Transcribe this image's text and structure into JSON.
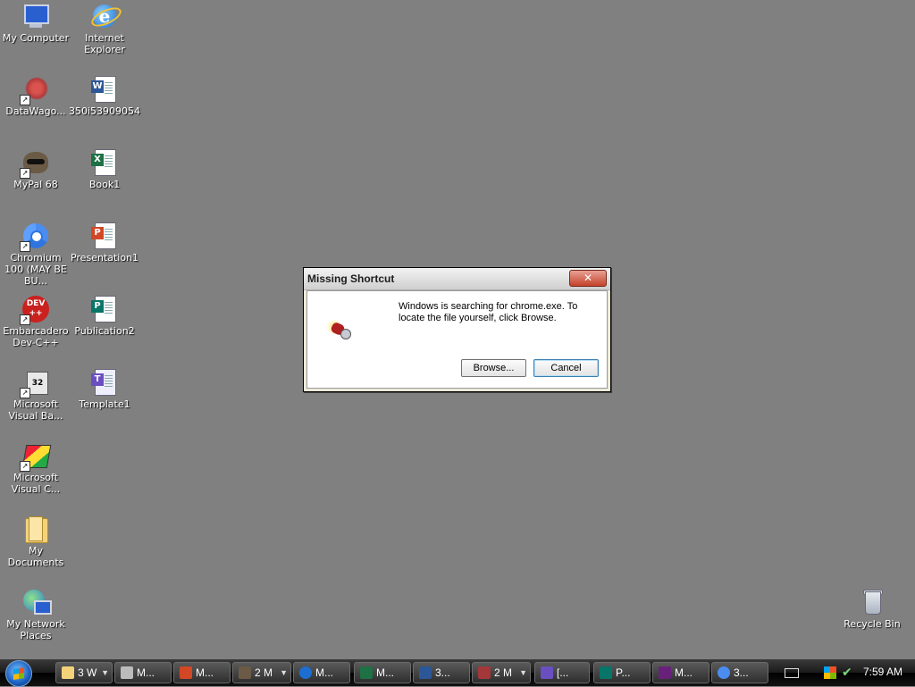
{
  "desktop": {
    "icons": [
      {
        "label": "My Computer",
        "icon": "my-computer-icon"
      },
      {
        "label": "Internet Explorer",
        "icon": "internet-explorer-icon"
      },
      {
        "label": "DataWago...",
        "icon": "datawago-shortcut-icon"
      },
      {
        "label": "350i53909054",
        "icon": "word-document-icon"
      },
      {
        "label": "MyPal 68",
        "icon": "mypal-raccoon-icon"
      },
      {
        "label": "Book1",
        "icon": "excel-workbook-icon"
      },
      {
        "label": "Chromium 100 (MAY BE BU...",
        "icon": "chromium-icon"
      },
      {
        "label": "Presentation1",
        "icon": "powerpoint-presentation-icon"
      },
      {
        "label": "Embarcadero Dev-C++",
        "icon": "devcpp-icon"
      },
      {
        "label": "Publication2",
        "icon": "publisher-document-icon"
      },
      {
        "label": "Microsoft Visual Ba...",
        "icon": "visual-basic-icon"
      },
      {
        "label": "Template1",
        "icon": "template-document-icon"
      },
      {
        "label": "Microsoft Visual C...",
        "icon": "visual-cpp-icon"
      },
      {
        "label": "My Documents",
        "icon": "my-documents-folder-icon"
      },
      {
        "label": "My Network Places",
        "icon": "network-places-icon"
      },
      {
        "label": "Recycle Bin",
        "icon": "recycle-bin-icon"
      }
    ]
  },
  "dialog": {
    "title": "Missing Shortcut",
    "close_label": "✕",
    "message": "Windows is searching for chrome.exe. To locate the file yourself, click Browse.",
    "browse_label": "Browse...",
    "cancel_label": "Cancel",
    "icon": "flashlight-search-icon"
  },
  "taskbar": {
    "items": [
      {
        "label": "3 W",
        "icon": "folder-icon",
        "has_dropdown": true
      },
      {
        "label": "M...",
        "icon": "paint-brush-icon",
        "has_dropdown": false
      },
      {
        "label": "M...",
        "icon": "powerpoint-icon",
        "has_dropdown": false
      },
      {
        "label": "2 M",
        "icon": "mypal-icon",
        "has_dropdown": true
      },
      {
        "label": "M...",
        "icon": "internet-explorer-icon",
        "has_dropdown": false
      },
      {
        "label": "M...",
        "icon": "excel-icon",
        "has_dropdown": false
      },
      {
        "label": "3...",
        "icon": "word-icon",
        "has_dropdown": false
      },
      {
        "label": "2 M",
        "icon": "access-icon",
        "has_dropdown": true
      },
      {
        "label": "[...",
        "icon": "template-icon",
        "has_dropdown": false
      },
      {
        "label": "P...",
        "icon": "publisher-icon",
        "has_dropdown": false
      },
      {
        "label": "M...",
        "icon": "visual-studio-icon",
        "has_dropdown": false
      },
      {
        "label": "3...",
        "icon": "chromium-icon",
        "has_dropdown": false
      }
    ],
    "clock": "7:59 AM"
  },
  "colors": {
    "desktop_bg": "#808080",
    "close_button": "#c4422a",
    "default_button_border": "#3c7fb1"
  }
}
